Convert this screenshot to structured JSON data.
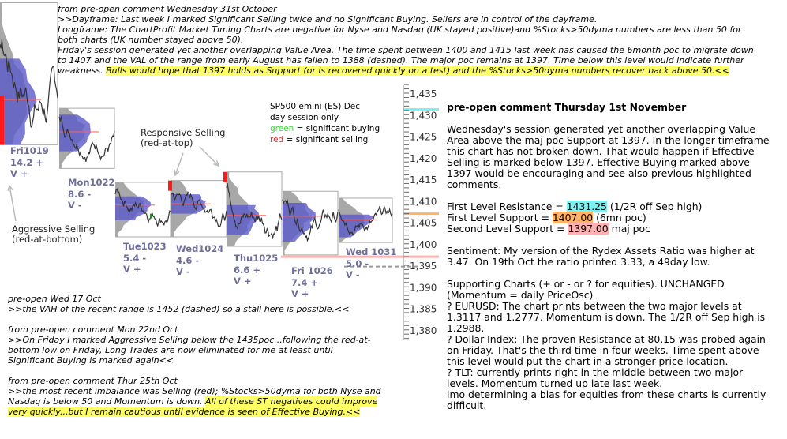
{
  "top_comment": {
    "lines": [
      "from pre-open comment Wednesday 31st October",
      ">>Dayframe: Last week I marked Significant Selling twice and no Significant Buying.  Sellers are in control of the dayframe.",
      "Longframe: The ChartProfit Market Timing Charts are negative for Nyse and Nasdaq (UK stayed positive)and %Stocks>50dyma numbers are less than 50 for",
      "both charts (UK number stayed above 50).",
      "Friday's session generated yet another overlapping Value Area. The time spent between 1400 and 1415 last week has caused the 6month poc to migrate down",
      "to 1407 and the VAL of the range from early August has fallen to 1388 (dashed).  The major poc remains at 1397. Time below this level would indicate further"
    ],
    "last_plain": "weakness. ",
    "last_highlight": "Bulls would hope that 1397 holds as Support (or is recovered quickly on a test) and the %Stocks>50dyma numbers recover back above 50.<<"
  },
  "right_panel": {
    "title": "pre-open comment Thursday 1st November",
    "para1": [
      "Wednesday's session generated yet another overlapping Value",
      "Area above the maj poc Support at 1397.  In the longer timeframe",
      "this chart has not broken down.  That would happen if Effective",
      "Selling is marked below 1397.  Effective Buying marked above",
      "1397 would be encouraging and see also previous highlighted",
      "comments."
    ],
    "levels": [
      {
        "label": "First Level Resistance = ",
        "value": "1431.25",
        "note": " (1/2R off Sep high)",
        "color": "#7ff0f0"
      },
      {
        "label": "First Level Support = ",
        "value": "1407.00",
        "note": " (6mn poc)",
        "color": "#ffb366"
      },
      {
        "label": "Second Level Support = ",
        "value": "1397.00",
        "note": " maj poc",
        "color": "#ffb0b0"
      }
    ],
    "sentiment": [
      "Sentiment: My version of the Rydex Assets Ratio was higher at",
      "3.47.  On 19th Oct the ratio printed 3.33, a 49day low."
    ],
    "supporting": [
      "Supporting Charts (+ or - or ? for equities).  UNCHANGED",
      "(Momentum = daily PriceOsc)",
      "? EURUSD:  The chart prints between the two major levels at",
      "1.3117 and 1.2777. Momentum is down. The 1/2R off Sep high is",
      "1.2988.",
      "? Dollar Index: The proven Resistance at 80.15 was probed again",
      "on Friday.  That's the third time in four weeks.  Time spent above",
      "this level would put the chart in a stronger price location.",
      "? TLT: currently prints right in the middle between two major",
      "levels. Momentum turned up late last week.",
      "imo determining a bias for equities from these charts is currently",
      "difficult."
    ]
  },
  "bottom_comments": {
    "c1": [
      "pre-open Wed 17 Oct",
      ">>the VAH of the recent range is 1452 (dashed) so a stall here is possible.<<"
    ],
    "c2": [
      "from pre-open comment Mon 22nd Oct",
      ">>On Friday I marked Aggressive Selling below the 1435poc...following the red-at-",
      "bottom low on Friday, Long Trades are now eliminated for me at least until",
      "Significant Buying is marked again<<"
    ],
    "c3": [
      "from pre-open comment Thur 25th Oct",
      ">>the most recent imbalance was Selling (red); %Stocks>50dyma for both Nyse and"
    ],
    "c3_last_plain": "Nasdaq is below 50 and Momentum is down.  ",
    "c3_highlight_1": "All of these ST negatives could improve",
    "c3_highlight_2": "very quickly...but I remain cautious until evidence is seen of Effective Buying.<<"
  },
  "annotations": {
    "responsive": [
      "Responsive Selling",
      "(red-at-top)"
    ],
    "aggressive": [
      "Aggressive Selling",
      "(red-at-bottom)"
    ]
  },
  "legend": {
    "line1": "SP500 emini (ES) Dec",
    "line2": "day session only",
    "green_word": "green",
    "green_rest": " = significant buying",
    "red_word": "red",
    "red_rest": " = significant selling",
    "green_color": "#33dd33",
    "red_color": "#ff2020"
  },
  "chart_data": {
    "type": "market-profile",
    "ylim": [
      1378,
      1437
    ],
    "yticks": [
      "1,435",
      "1,430",
      "1,425",
      "1,420",
      "1,415",
      "1,410",
      "1,405",
      "1,400",
      "1,395",
      "1,390",
      "1,385",
      "1,380"
    ],
    "ytick_values": [
      1435,
      1430,
      1425,
      1420,
      1415,
      1410,
      1405,
      1400,
      1395,
      1390,
      1385,
      1380
    ],
    "sessions": [
      {
        "name": "Fri1019",
        "range_stat": "14.2 +",
        "volume": "V +",
        "high": 1456,
        "low": 1423,
        "poc": 1433.5,
        "va_high": 1443,
        "va_low": 1423,
        "signal": "selling-bottom"
      },
      {
        "name": "Mon1022",
        "range_stat": "8.6 -",
        "volume": "V -",
        "high": 1431.5,
        "low": 1417.5,
        "poc": 1426,
        "va_high": 1430,
        "va_low": 1421.5,
        "signal": ""
      },
      {
        "name": "Tue1023",
        "range_stat": "5.4 -",
        "volume": "V +",
        "high": 1414.3,
        "low": 1401.6,
        "poc": 1409,
        "va_high": 1411,
        "va_low": 1405.5,
        "signal": "buying"
      },
      {
        "name": "Wed1024",
        "range_stat": "4.6 -",
        "volume": "V -",
        "high": 1414.7,
        "low": 1401.6,
        "poc": 1409.3,
        "va_high": 1411.5,
        "va_low": 1407,
        "signal": "selling-top"
      },
      {
        "name": "Thu1025",
        "range_stat": "6.6 +",
        "volume": "V +",
        "high": 1416.7,
        "low": 1399.4,
        "poc": 1406.6,
        "va_high": 1409,
        "va_low": 1402,
        "signal": "selling-top"
      },
      {
        "name": "Fri 1026",
        "range_stat": "7.4 +",
        "volume": "V +",
        "high": 1412.2,
        "low": 1397.4,
        "poc": 1406.4,
        "va_high": 1409.5,
        "va_low": 1400.5,
        "signal": ""
      },
      {
        "name": "Wed 1031",
        "range_stat": "5.0 -",
        "volume": "V -",
        "high": 1410.6,
        "low": 1400.3,
        "poc": 1405.6,
        "va_high": 1406.8,
        "va_low": 1401.5,
        "signal": ""
      }
    ],
    "levels": [
      {
        "value": 1431.25,
        "color": "#7ff0f0",
        "style": "solid"
      },
      {
        "value": 1407.0,
        "color": "#ffb366",
        "style": "solid"
      },
      {
        "value": 1397.0,
        "color": "#ffb0b0",
        "style": "solid"
      },
      {
        "value": 1394.7,
        "color": "#999999",
        "style": "dashed"
      }
    ]
  }
}
